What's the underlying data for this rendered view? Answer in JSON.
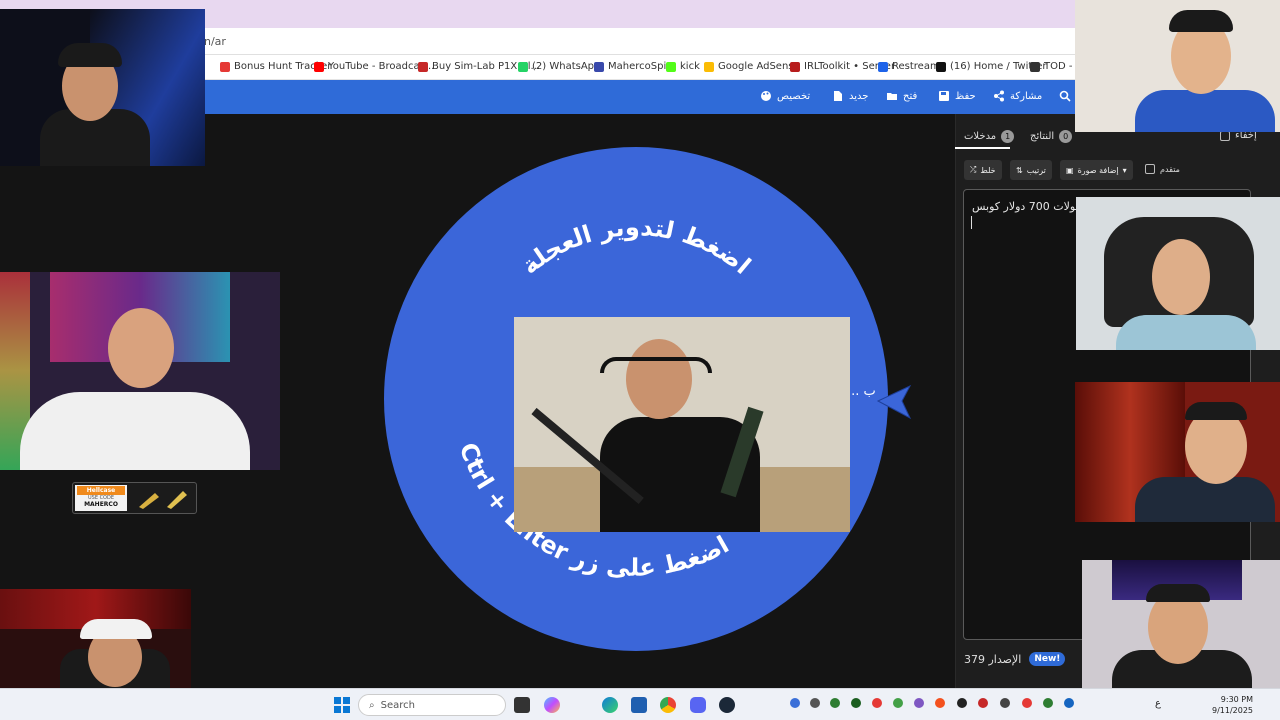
{
  "browser": {
    "url_fragment": "n/ar",
    "bookmarks": [
      {
        "label": "Bonus Hunt Tracker",
        "color": "#e53935"
      },
      {
        "label": "YouTube - Broadcas...",
        "color": "#ff0000"
      },
      {
        "label": "Buy Sim-Lab P1X Ul...",
        "color": "#c62828"
      },
      {
        "label": "(2) WhatsApp",
        "color": "#25d366"
      },
      {
        "label": "MahercoSpin",
        "color": "#3949ab"
      },
      {
        "label": "kick",
        "color": "#53fc18"
      },
      {
        "label": "Google AdSense",
        "color": "#fbbc04"
      },
      {
        "label": "IRLToolkit • Server",
        "color": "#b71c1c"
      },
      {
        "label": "Restream",
        "color": "#1e63e9"
      },
      {
        "label": "(16) Home / Twitter",
        "color": "#111111"
      },
      {
        "label": "TOD - Ho",
        "color": "#333333"
      }
    ]
  },
  "toolbar": {
    "customize": "تخصيص",
    "new": "جديد",
    "open": "فتح",
    "save": "حفظ",
    "share": "مشاركة"
  },
  "wheel": {
    "top_text": "اضغط لتدوير العجلة",
    "bottom_text": "Ctrl + Enter اضغط على زر",
    "entry_label_partial": "... ب",
    "color": "#3b66d9"
  },
  "panel": {
    "tab_entries": {
      "label": "مدخلات",
      "count": "1"
    },
    "tab_results": {
      "label": "النتائج",
      "count": "0"
    },
    "hide_label": "إخفاء",
    "shuffle_label": "خلط",
    "sort_label": "ترتيب",
    "add_image_label": "إضافة صورة",
    "advanced_label": "متقدم",
    "entry_text": "بطولات 700 دولار كوبس",
    "version_label": "الإصدار 379",
    "new_badge": "New!"
  },
  "sponsor": {
    "brand": "Hellcase",
    "code_label": "USE CODE",
    "code": "MAHERCO"
  },
  "taskbar": {
    "search_placeholder": "Search",
    "lang": "ع",
    "time": "9:30 PM",
    "date": "9/11/2025"
  }
}
